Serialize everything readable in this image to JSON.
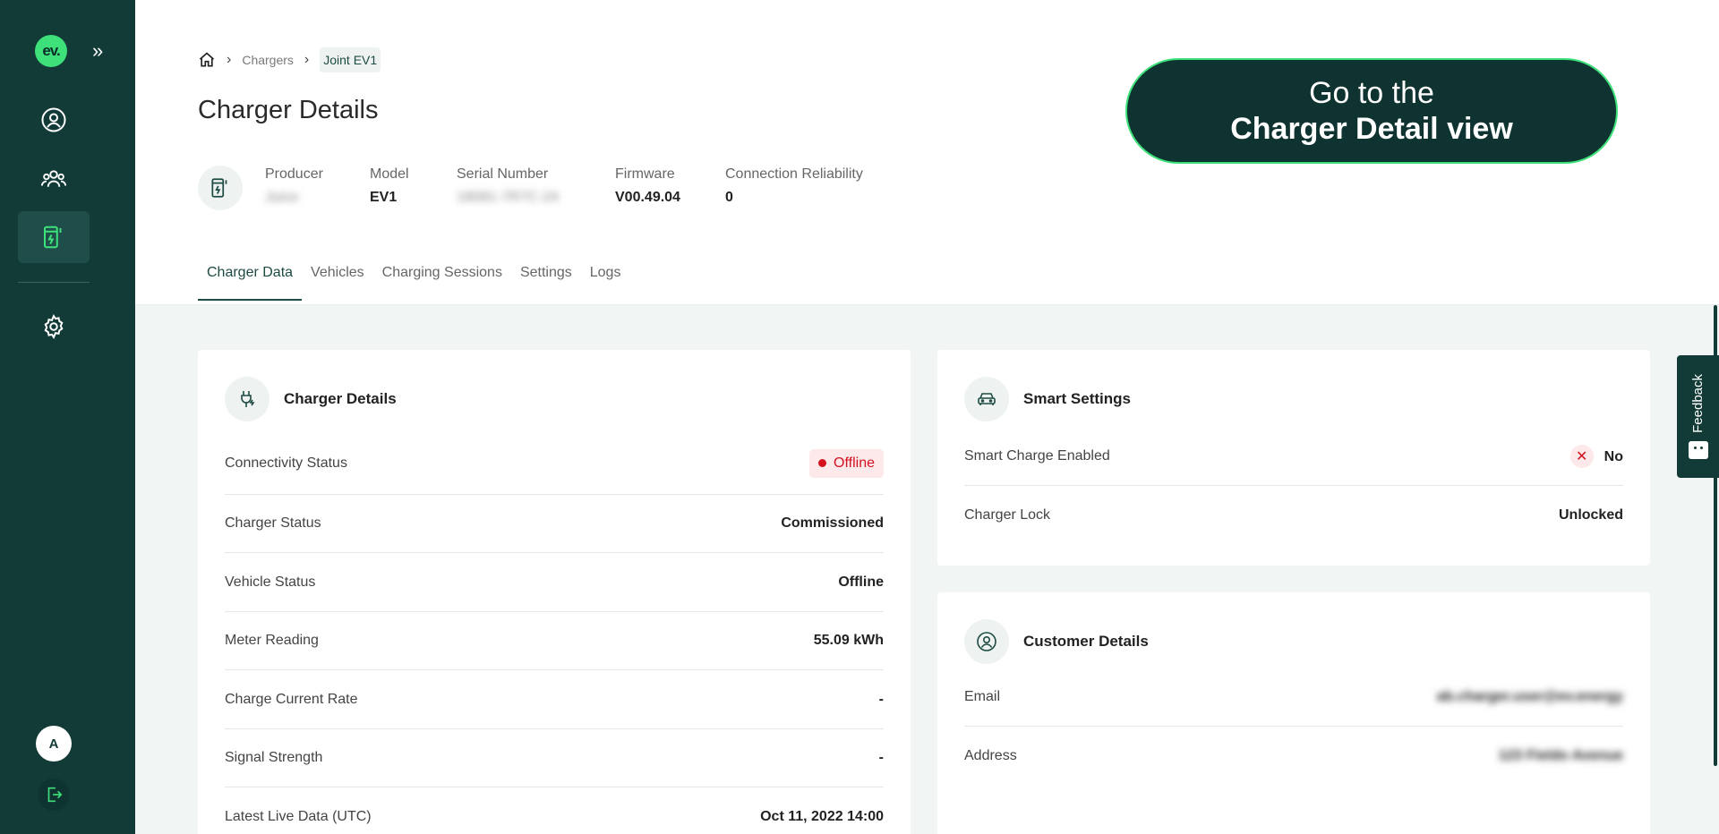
{
  "sidebar": {
    "logo_text": "ev.",
    "avatar_initial": "A"
  },
  "breadcrumb": {
    "items": [
      "Chargers",
      "Joint EV1"
    ]
  },
  "page_title": "Charger Details",
  "charger_info": {
    "producer_label": "Producer",
    "producer_value": "Juice",
    "model_label": "Model",
    "model_value": "EV1",
    "serial_label": "Serial Number",
    "serial_value": "18081-7R7C-24",
    "firmware_label": "Firmware",
    "firmware_value": "V00.49.04",
    "reliability_label": "Connection Reliability",
    "reliability_value": "0"
  },
  "cta": {
    "line1": "Go to the",
    "line2": "Charger Detail view"
  },
  "tabs": [
    "Charger Data",
    "Vehicles",
    "Charging Sessions",
    "Settings",
    "Logs"
  ],
  "charger_card": {
    "title": "Charger Details",
    "rows": [
      {
        "label": "Connectivity Status",
        "value": "Offline"
      },
      {
        "label": "Charger Status",
        "value": "Commissioned"
      },
      {
        "label": "Vehicle Status",
        "value": "Offline"
      },
      {
        "label": "Meter Reading",
        "value": "55.09 kWh"
      },
      {
        "label": "Charge Current Rate",
        "value": "-"
      },
      {
        "label": "Signal Strength",
        "value": "-"
      },
      {
        "label": "Latest Live Data (UTC)",
        "value": "Oct 11, 2022 14:00"
      }
    ]
  },
  "smart_card": {
    "title": "Smart Settings",
    "rows": [
      {
        "label": "Smart Charge Enabled",
        "value": "No"
      },
      {
        "label": "Charger Lock",
        "value": "Unlocked"
      }
    ]
  },
  "customer_card": {
    "title": "Customer Details",
    "email_label": "Email",
    "email_value": "ab.charger.user@ev.energy",
    "address_label": "Address",
    "address_value": "123 Fieldo Avenue"
  },
  "feedback_label": "Feedback",
  "colors": {
    "sidebar": "#123b38",
    "accent": "#3ee07a",
    "offline": "#d3121f"
  }
}
